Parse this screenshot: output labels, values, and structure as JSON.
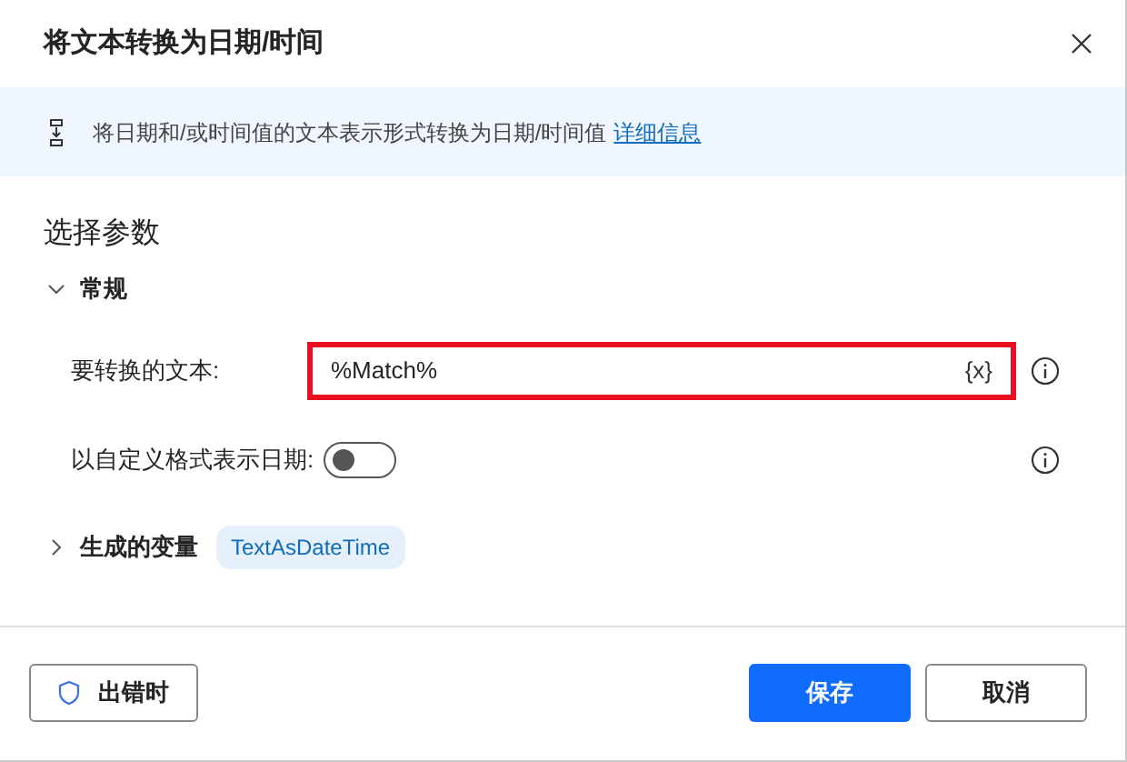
{
  "window": {
    "title": "将文本转换为日期/时间"
  },
  "info": {
    "text": "将日期和/或时间值的文本表示形式转换为日期/时间值",
    "link": "详细信息"
  },
  "section_title": "选择参数",
  "general": {
    "label": "常规",
    "expanded": true
  },
  "params": [
    {
      "kind": "text",
      "label": "要转换的文本:",
      "value": "%Match%",
      "variable_button": "{x}",
      "highlighted": true
    },
    {
      "kind": "toggle",
      "label": "以自定义格式表示日期:",
      "on": false
    }
  ],
  "variables": {
    "label": "生成的变量",
    "expanded": false,
    "tag": "TextAsDateTime"
  },
  "footer": {
    "error_button": "出错时",
    "save": "保存",
    "cancel": "取消"
  }
}
